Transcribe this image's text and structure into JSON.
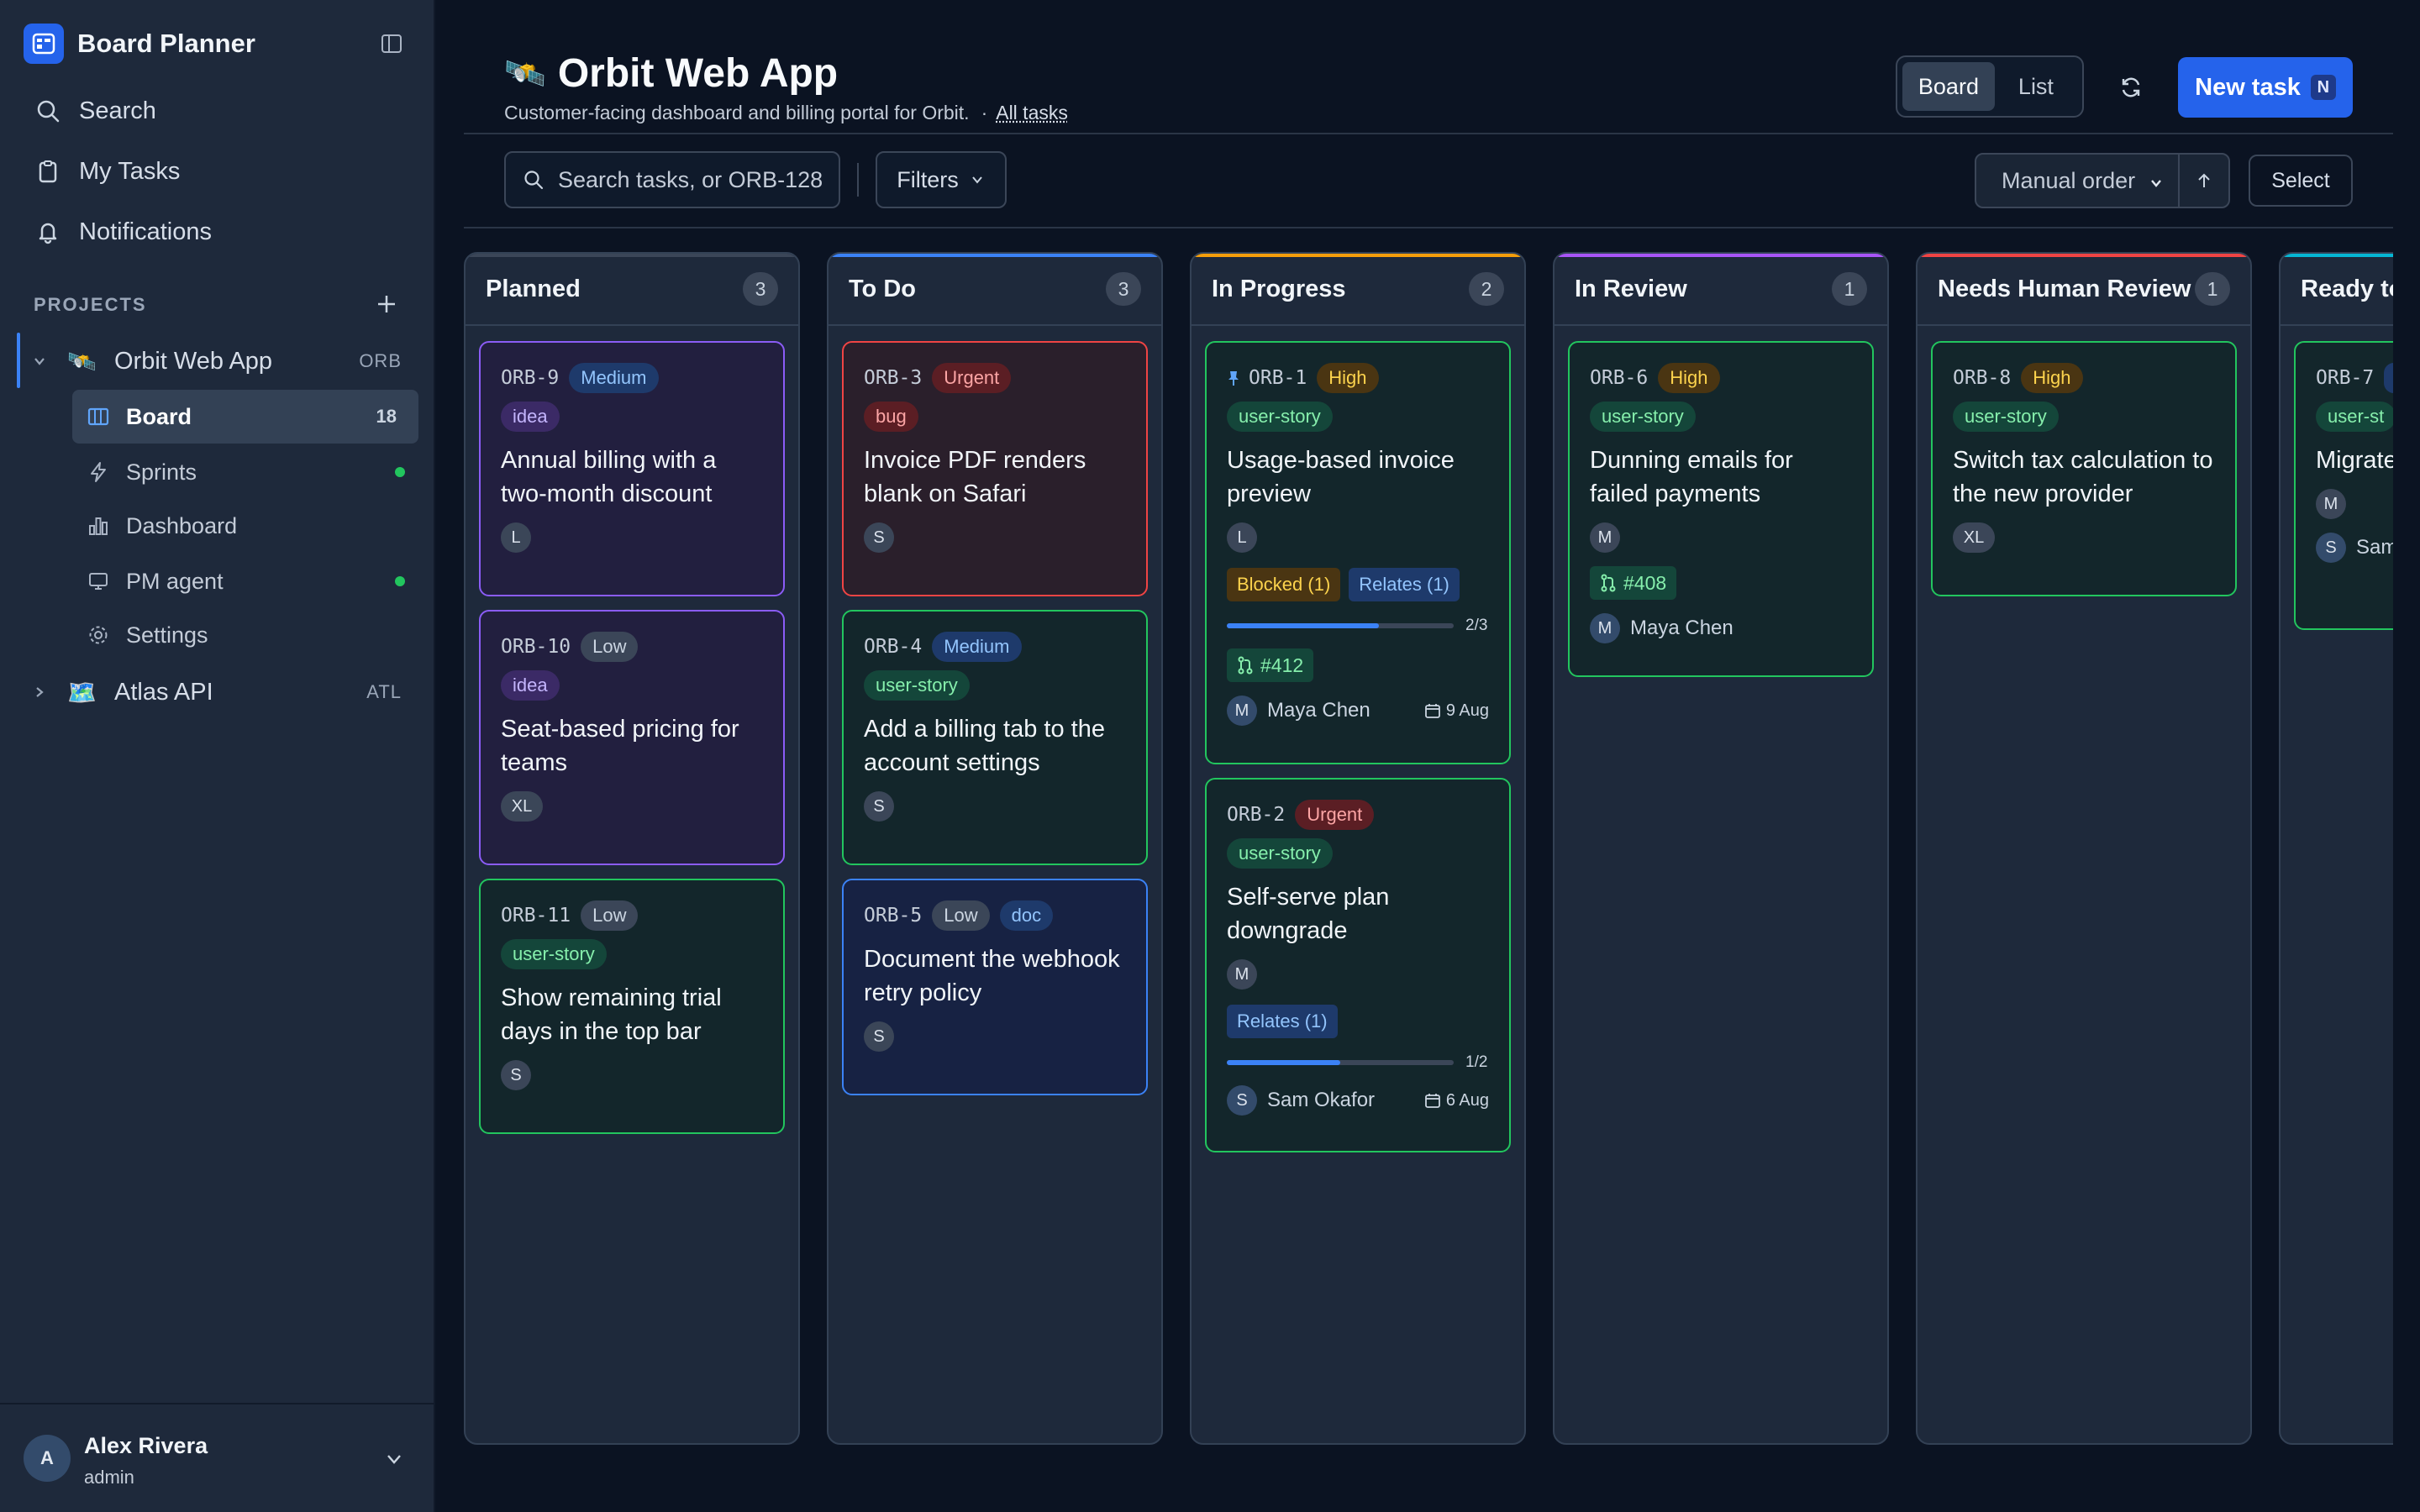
{
  "app": {
    "title": "Board Planner"
  },
  "nav": {
    "search": "Search",
    "my_tasks": "My Tasks",
    "notifications": "Notifications"
  },
  "projects": {
    "label": "PROJECTS",
    "items": [
      {
        "emoji": "🛰️",
        "name": "Orbit Web App",
        "key": "ORB"
      },
      {
        "emoji": "🗺️",
        "name": "Atlas API",
        "key": "ATL"
      }
    ],
    "sub_items": [
      {
        "label": "Board",
        "count": "18"
      },
      {
        "label": "Sprints"
      },
      {
        "label": "Dashboard"
      },
      {
        "label": "PM agent"
      },
      {
        "label": "Settings"
      }
    ]
  },
  "user": {
    "initial": "A",
    "name": "Alex Rivera",
    "role": "admin"
  },
  "header": {
    "emoji": "🛰️",
    "title": "Orbit Web App",
    "subtitle": "Customer-facing dashboard and billing portal for Orbit.",
    "separator": "·",
    "all_tasks": "All tasks",
    "view_board": "Board",
    "view_list": "List",
    "new_task": "New task",
    "new_task_kbd": "N"
  },
  "toolbar": {
    "search_placeholder": "Search tasks, or ORB-128",
    "filters": "Filters",
    "order": "Manual order",
    "select": "Select"
  },
  "colors": {
    "planned": "#3b4658",
    "todo": "#3b82f6",
    "in_progress": "#f59e0b",
    "in_review": "#a855f7",
    "needs_review": "#ef4444",
    "ready": "#06b6d4"
  },
  "columns": [
    {
      "title": "Planned",
      "count": "3",
      "cards": [
        {
          "id": "ORB-9",
          "priority": "Medium",
          "tags": [
            "idea"
          ],
          "title": "Annual billing with a two-month discount",
          "assignee": "L"
        },
        {
          "id": "ORB-10",
          "priority": "Low",
          "tags": [
            "idea"
          ],
          "title": "Seat-based pricing for teams",
          "assignee": "XL"
        },
        {
          "id": "ORB-11",
          "priority": "Low",
          "tags": [
            "user-story"
          ],
          "title": "Show remaining trial days in the top bar",
          "assignee": "S"
        }
      ]
    },
    {
      "title": "To Do",
      "count": "3",
      "cards": [
        {
          "id": "ORB-3",
          "priority": "Urgent",
          "tags": [
            "bug"
          ],
          "title": "Invoice PDF renders blank on Safari",
          "assignee": "S"
        },
        {
          "id": "ORB-4",
          "priority": "Medium",
          "tags": [
            "user-story"
          ],
          "title": "Add a billing tab to the account settings",
          "assignee": "S"
        },
        {
          "id": "ORB-5",
          "priority": "Low",
          "tags": [
            "doc"
          ],
          "title": "Document the webhook retry policy",
          "assignee": "S"
        }
      ]
    },
    {
      "title": "In Progress",
      "count": "2",
      "cards": [
        {
          "id": "ORB-1",
          "priority": "High",
          "tags": [
            "user-story"
          ],
          "title": "Usage-based invoice preview",
          "assignee": "L",
          "blocked": "Blocked (1)",
          "relates": "Relates (1)",
          "progress": 0.67,
          "progress_text": "2/3",
          "pr": "#412",
          "owner_initial": "M",
          "owner": "Maya Chen",
          "due": "9 Aug"
        },
        {
          "id": "ORB-2",
          "priority": "Urgent",
          "tags": [
            "user-story"
          ],
          "title": "Self-serve plan downgrade",
          "assignee": "M",
          "relates": "Relates (1)",
          "progress": 0.5,
          "progress_text": "1/2",
          "owner_initial": "S",
          "owner": "Sam Okafor",
          "due": "6 Aug"
        }
      ]
    },
    {
      "title": "In Review",
      "count": "1",
      "cards": [
        {
          "id": "ORB-6",
          "priority": "High",
          "tags": [
            "user-story"
          ],
          "title": "Dunning emails for failed payments",
          "assignee": "M",
          "pr": "#408",
          "owner_initial": "M",
          "owner": "Maya Chen"
        }
      ]
    },
    {
      "title": "Needs Human Review",
      "count": "1",
      "cards": [
        {
          "id": "ORB-8",
          "priority": "High",
          "tags": [
            "user-story"
          ],
          "title": "Switch tax calculation to the new provider",
          "assignee": "XL"
        }
      ]
    },
    {
      "title": "Ready to",
      "cards": [
        {
          "id": "ORB-7",
          "tags": [
            "user-st"
          ],
          "title": "Migrate table to",
          "assignee": "M",
          "owner_initial": "S",
          "owner": "Sam"
        }
      ]
    }
  ]
}
